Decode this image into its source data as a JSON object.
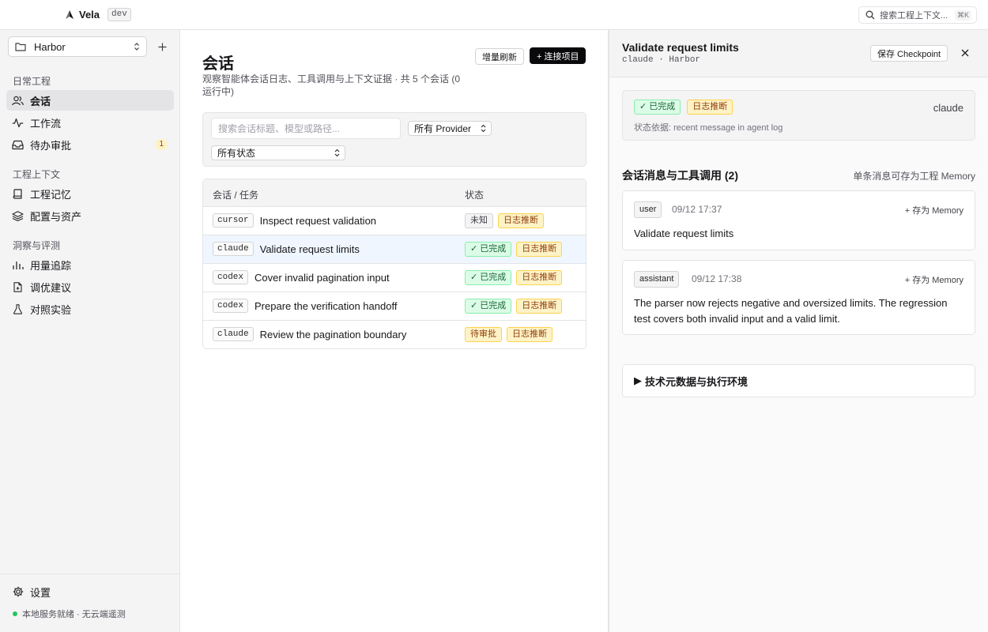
{
  "app": {
    "name": "Vela",
    "env": "dev"
  },
  "topbar": {
    "search_placeholder": "搜索工程上下文...",
    "search_shortcut": "⌘K"
  },
  "sidebar": {
    "project": "Harbor",
    "sections": [
      {
        "heading": "日常工程",
        "items": [
          {
            "label": "会话",
            "icon": "users-icon",
            "active": true
          },
          {
            "label": "工作流",
            "icon": "activity-icon"
          },
          {
            "label": "待办审批",
            "icon": "inbox-icon",
            "badge": "1"
          }
        ]
      },
      {
        "heading": "工程上下文",
        "items": [
          {
            "label": "工程记忆",
            "icon": "book-icon"
          },
          {
            "label": "配置与资产",
            "icon": "layers-icon"
          }
        ]
      },
      {
        "heading": "洞察与评测",
        "items": [
          {
            "label": "用量追踪",
            "icon": "bar-chart-icon"
          },
          {
            "label": "调优建议",
            "icon": "file-plus-icon"
          },
          {
            "label": "对照实验",
            "icon": "flask-icon"
          }
        ]
      }
    ],
    "settings_label": "设置",
    "service_status": "本地服务就绪 · 无云端遥测"
  },
  "main": {
    "title": "会话",
    "subtitle": "观察智能体会话日志、工具调用与上下文证据 · 共 5 个会话 (0 运行中)",
    "refresh_button": "增量刷新",
    "connect_button": "+ 连接项目",
    "filters": {
      "search_placeholder": "搜索会话标题、模型或路径...",
      "provider_select": "所有 Provider",
      "status_select": "所有状态"
    },
    "table": {
      "headers": [
        "会话 / 任务",
        "状态"
      ],
      "rows": [
        {
          "provider": "cursor",
          "title": "Inspect request validation",
          "status": "未知",
          "status_kind": "unknown",
          "source": "日志推断"
        },
        {
          "provider": "claude",
          "title": "Validate request limits",
          "status": "✓ 已完成",
          "status_kind": "done",
          "source": "日志推断",
          "selected": true
        },
        {
          "provider": "codex",
          "title": "Cover invalid pagination input",
          "status": "✓ 已完成",
          "status_kind": "done",
          "source": "日志推断"
        },
        {
          "provider": "codex",
          "title": "Prepare the verification handoff",
          "status": "✓ 已完成",
          "status_kind": "done",
          "source": "日志推断"
        },
        {
          "provider": "claude",
          "title": "Review the pagination boundary",
          "status": "待审批",
          "status_kind": "pending",
          "source": "日志推断"
        }
      ]
    }
  },
  "detail": {
    "title": "Validate request limits",
    "meta": "claude · Harbor",
    "save_checkpoint": "保存 Checkpoint",
    "status": {
      "state": "✓ 已完成",
      "source": "日志推断",
      "provider": "claude",
      "basis": "状态依据: recent message in agent log"
    },
    "messages_title": "会话消息与工具调用 (2)",
    "messages_hint": "单条消息可存为工程 Memory",
    "messages": [
      {
        "role": "user",
        "time": "09/12 17:37",
        "save": "+ 存为 Memory",
        "body": "Validate request limits"
      },
      {
        "role": "assistant",
        "time": "09/12 17:38",
        "save": "+ 存为 Memory",
        "body": "The parser now rejects negative and oversized limits. The regression test covers both invalid input and a valid limit."
      }
    ],
    "tech_section": "技术元数据与执行环境",
    "tech_toggle": "▶"
  },
  "colors": {
    "accent_dark": "#09090b",
    "done_bg": "#dcfce7",
    "infer_bg": "#fef3c7",
    "selected_row": "#eff6ff",
    "ok_dot": "#22c55e"
  }
}
